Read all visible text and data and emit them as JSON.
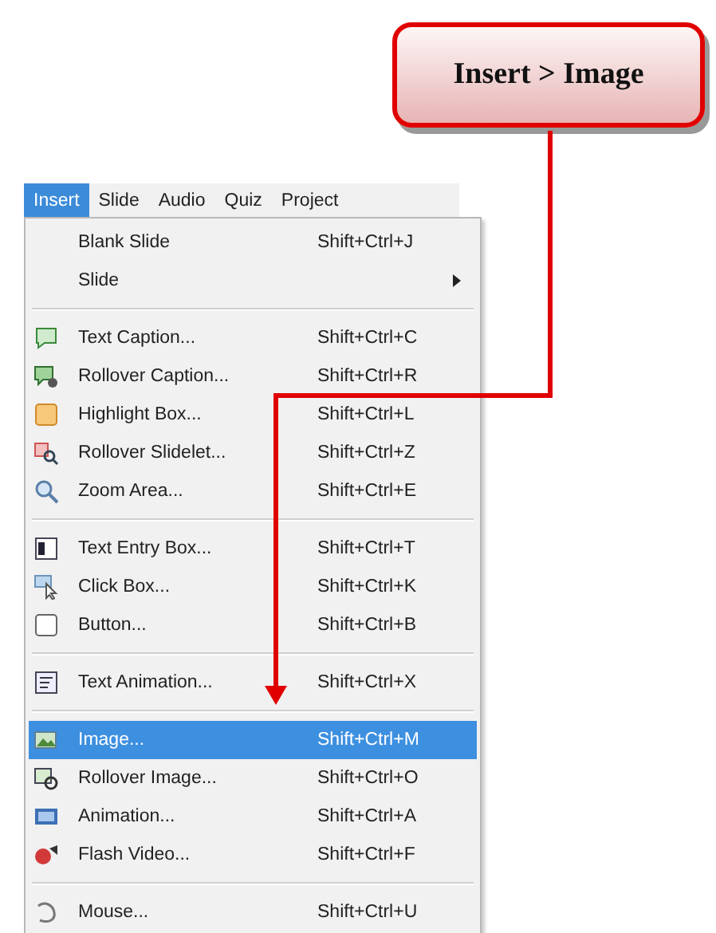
{
  "callout": {
    "text": "Insert > Image"
  },
  "menubar": [
    {
      "label": "Insert",
      "selected": true
    },
    {
      "label": "Slide",
      "selected": false
    },
    {
      "label": "Audio",
      "selected": false
    },
    {
      "label": "Quiz",
      "selected": false
    },
    {
      "label": "Project",
      "selected": false
    }
  ],
  "menu": {
    "groups": [
      [
        {
          "label": "Blank Slide",
          "shortcut": "Shift+Ctrl+J",
          "submenu": false,
          "selected": false
        },
        {
          "label": "Slide",
          "submenu": true,
          "selected": false
        }
      ],
      [
        {
          "label": "Text Caption...",
          "shortcut": "Shift+Ctrl+C",
          "submenu": false,
          "selected": false
        },
        {
          "label": "Rollover Caption...",
          "shortcut": "Shift+Ctrl+R",
          "submenu": false,
          "selected": false
        },
        {
          "label": "Highlight Box...",
          "shortcut": "Shift+Ctrl+L",
          "submenu": false,
          "selected": false
        },
        {
          "label": "Rollover Slidelet...",
          "shortcut": "Shift+Ctrl+Z",
          "submenu": false,
          "selected": false
        },
        {
          "label": "Zoom Area...",
          "shortcut": "Shift+Ctrl+E",
          "submenu": false,
          "selected": false
        }
      ],
      [
        {
          "label": "Text Entry Box...",
          "shortcut": "Shift+Ctrl+T",
          "submenu": false,
          "selected": false
        },
        {
          "label": "Click Box...",
          "shortcut": "Shift+Ctrl+K",
          "submenu": false,
          "selected": false
        },
        {
          "label": "Button...",
          "shortcut": "Shift+Ctrl+B",
          "submenu": false,
          "selected": false
        }
      ],
      [
        {
          "label": "Text Animation...",
          "shortcut": "Shift+Ctrl+X",
          "submenu": false,
          "selected": false
        }
      ],
      [
        {
          "label": "Image...",
          "shortcut": "Shift+Ctrl+M",
          "submenu": false,
          "selected": true
        },
        {
          "label": "Rollover Image...",
          "shortcut": "Shift+Ctrl+O",
          "submenu": false,
          "selected": false
        },
        {
          "label": "Animation...",
          "shortcut": "Shift+Ctrl+A",
          "submenu": false,
          "selected": false
        },
        {
          "label": "Flash Video...",
          "shortcut": "Shift+Ctrl+F",
          "submenu": false,
          "selected": false
        }
      ],
      [
        {
          "label": "Mouse...",
          "shortcut": "Shift+Ctrl+U",
          "submenu": false,
          "selected": false
        }
      ]
    ]
  }
}
